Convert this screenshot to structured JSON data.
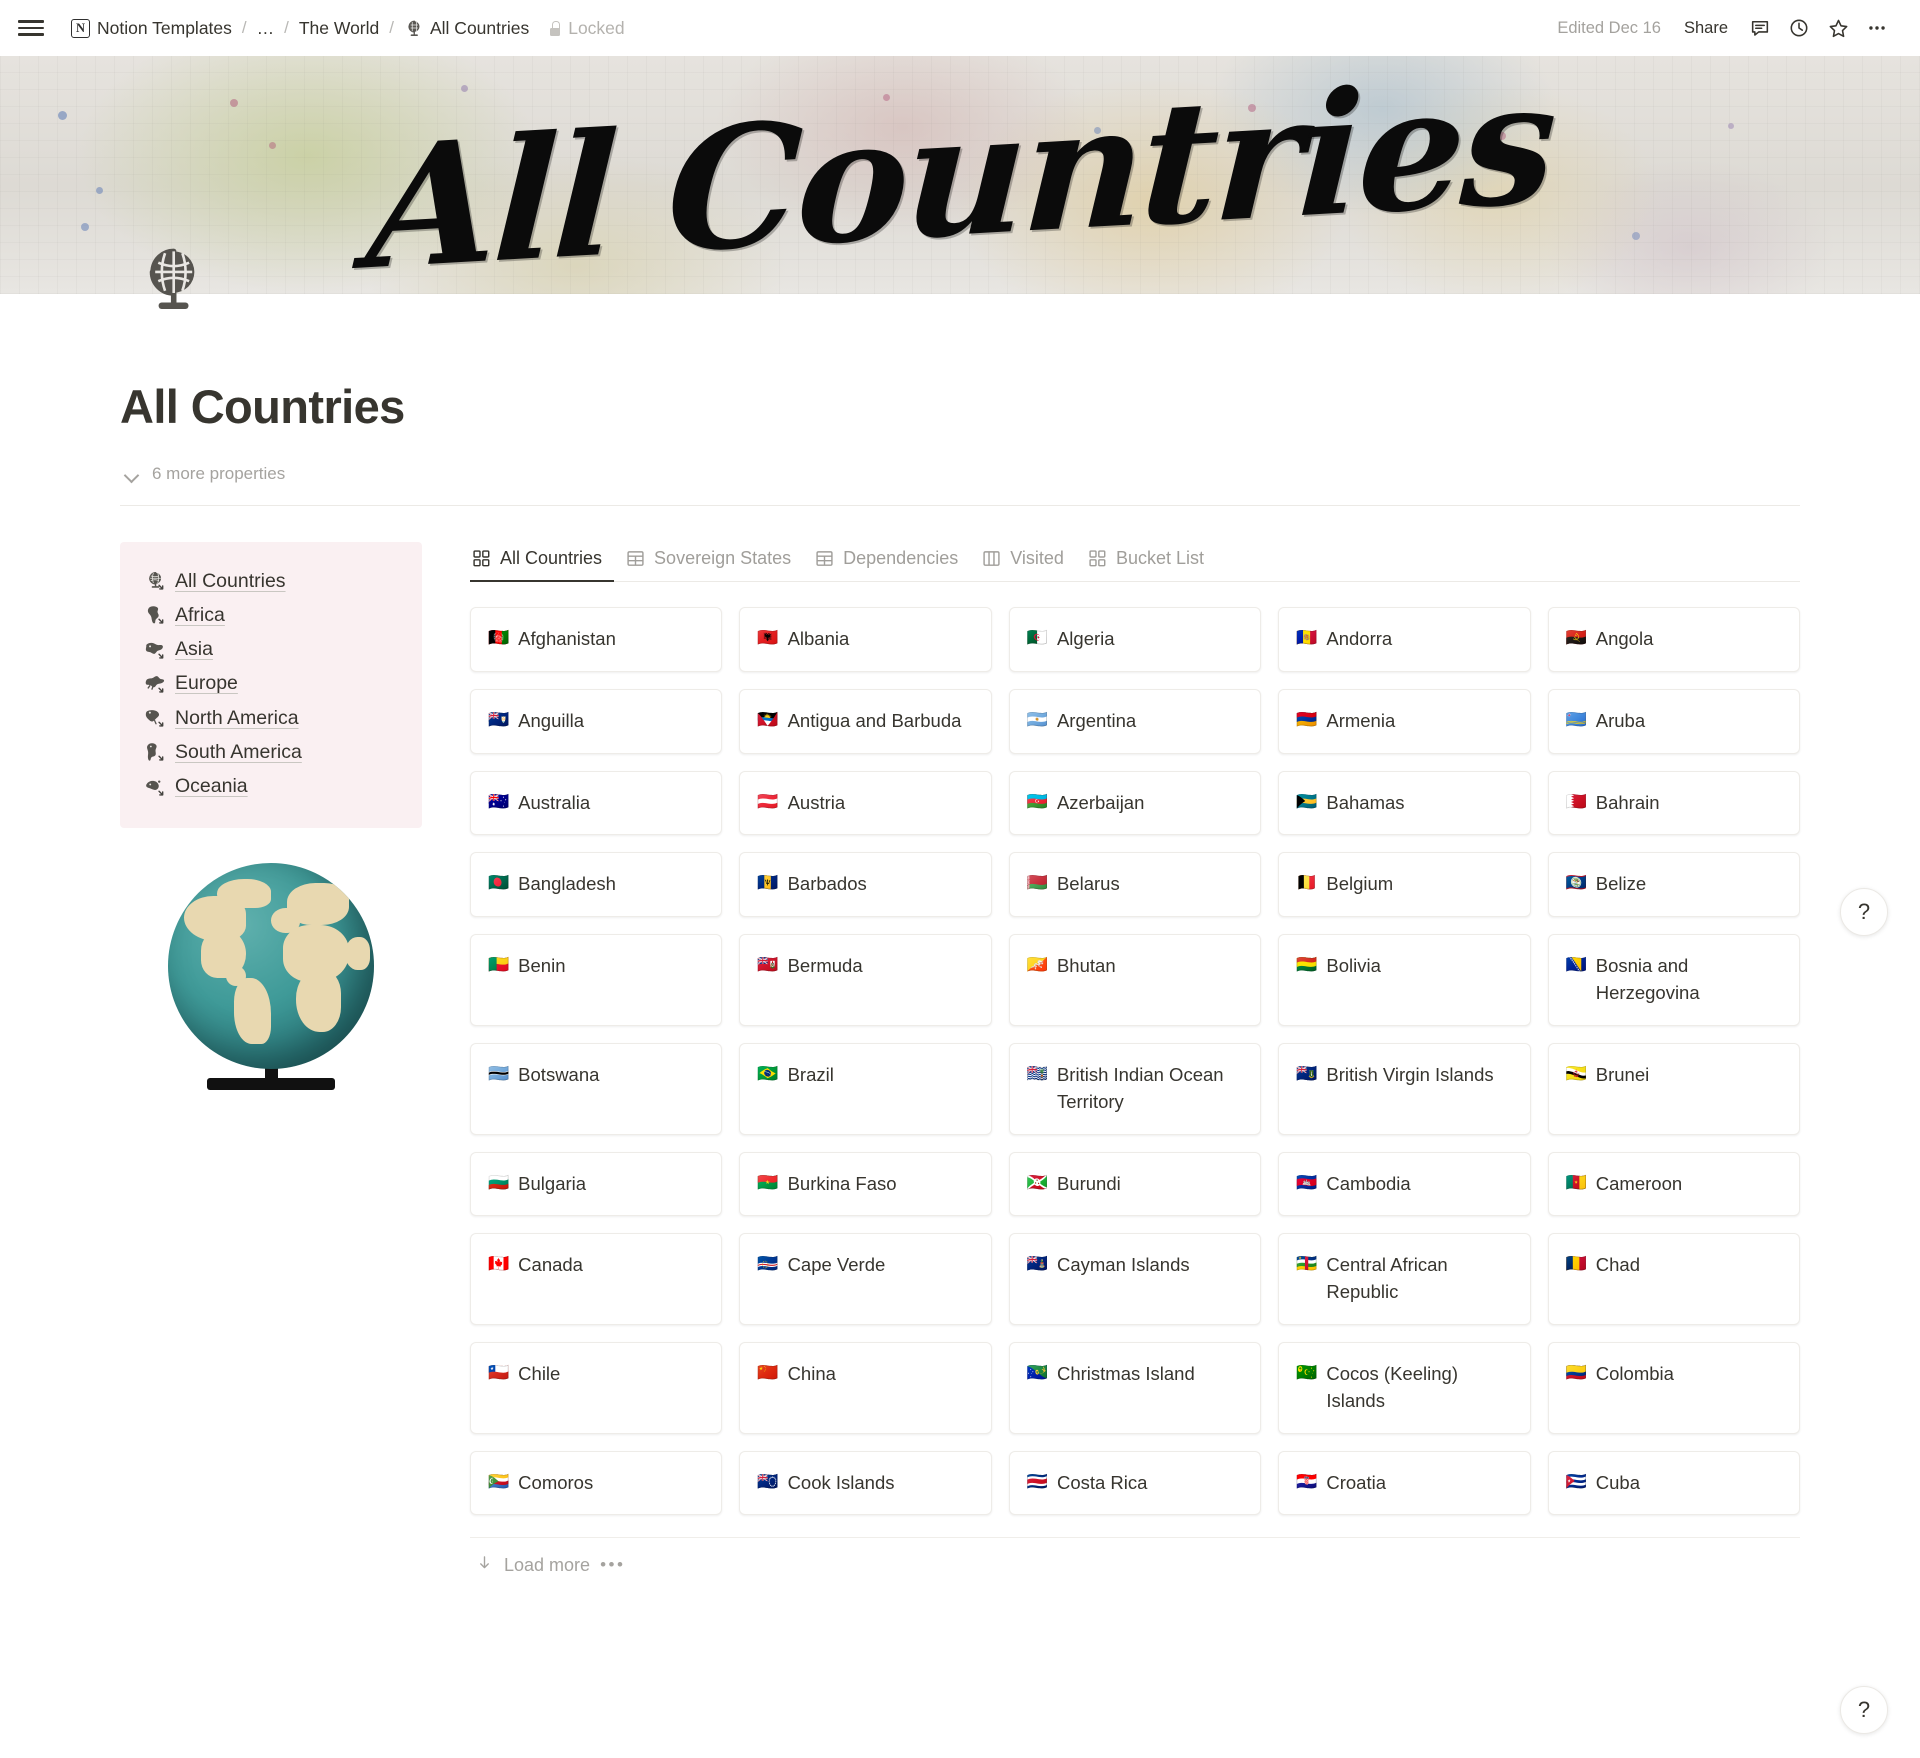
{
  "topbar": {
    "menu_icon": "hamburger-icon",
    "breadcrumb": {
      "workspace": "Notion Templates",
      "ellipsis": "…",
      "parent": "The World",
      "current": "All Countries",
      "separator": "/"
    },
    "locked_label": "Locked",
    "lock_icon": "lock-icon",
    "edited_label": "Edited Dec 16",
    "share_label": "Share",
    "icons": [
      "comment-icon",
      "history-clock-icon",
      "star-icon",
      "more-options-icon"
    ],
    "more_label": "•••"
  },
  "cover": {
    "title_script": "All Countries",
    "alt": "world-map-cover"
  },
  "page": {
    "icon": "globe-stand-icon",
    "title": "All Countries",
    "properties_toggle": "6 more properties",
    "properties_count": 6
  },
  "sidebar": {
    "background_color": "#faf0f2",
    "items": [
      {
        "label": "All Countries",
        "icon": "globe-stand-icon"
      },
      {
        "label": "Africa",
        "icon": "map-africa-icon"
      },
      {
        "label": "Asia",
        "icon": "map-asia-icon"
      },
      {
        "label": "Europe",
        "icon": "map-europe-icon"
      },
      {
        "label": "North America",
        "icon": "map-north-america-icon"
      },
      {
        "label": "South America",
        "icon": "map-south-america-icon"
      },
      {
        "label": "Oceania",
        "icon": "map-oceania-icon"
      }
    ],
    "illustration": "globe-on-stand-image"
  },
  "database": {
    "tabs": [
      {
        "label": "All Countries",
        "icon": "gallery-view-icon",
        "active": true
      },
      {
        "label": "Sovereign States",
        "icon": "table-view-icon",
        "active": false
      },
      {
        "label": "Dependencies",
        "icon": "table-view-icon",
        "active": false
      },
      {
        "label": "Visited",
        "icon": "board-view-icon",
        "active": false
      },
      {
        "label": "Bucket List",
        "icon": "gallery-view-icon",
        "active": false
      }
    ],
    "load_more_label": "Load more",
    "load_more_icon": "arrow-down-icon",
    "load_more_more": "•••",
    "cards": [
      {
        "name": "Afghanistan",
        "flag": "🇦🇫"
      },
      {
        "name": "Albania",
        "flag": "🇦🇱"
      },
      {
        "name": "Algeria",
        "flag": "🇩🇿"
      },
      {
        "name": "Andorra",
        "flag": "🇦🇩"
      },
      {
        "name": "Angola",
        "flag": "🇦🇴"
      },
      {
        "name": "Anguilla",
        "flag": "🇦🇮"
      },
      {
        "name": "Antigua and Barbuda",
        "flag": "🇦🇬"
      },
      {
        "name": "Argentina",
        "flag": "🇦🇷"
      },
      {
        "name": "Armenia",
        "flag": "🇦🇲"
      },
      {
        "name": "Aruba",
        "flag": "🇦🇼"
      },
      {
        "name": "Australia",
        "flag": "🇦🇺"
      },
      {
        "name": "Austria",
        "flag": "🇦🇹"
      },
      {
        "name": "Azerbaijan",
        "flag": "🇦🇿"
      },
      {
        "name": "Bahamas",
        "flag": "🇧🇸"
      },
      {
        "name": "Bahrain",
        "flag": "🇧🇭"
      },
      {
        "name": "Bangladesh",
        "flag": "🇧🇩"
      },
      {
        "name": "Barbados",
        "flag": "🇧🇧"
      },
      {
        "name": "Belarus",
        "flag": "🇧🇾"
      },
      {
        "name": "Belgium",
        "flag": "🇧🇪"
      },
      {
        "name": "Belize",
        "flag": "🇧🇿"
      },
      {
        "name": "Benin",
        "flag": "🇧🇯"
      },
      {
        "name": "Bermuda",
        "flag": "🇧🇲"
      },
      {
        "name": "Bhutan",
        "flag": "🇧🇹"
      },
      {
        "name": "Bolivia",
        "flag": "🇧🇴"
      },
      {
        "name": "Bosnia and Herzegovina",
        "flag": "🇧🇦"
      },
      {
        "name": "Botswana",
        "flag": "🇧🇼"
      },
      {
        "name": "Brazil",
        "flag": "🇧🇷"
      },
      {
        "name": "British Indian Ocean Territory",
        "flag": "🇮🇴"
      },
      {
        "name": "British Virgin Islands",
        "flag": "🇻🇬"
      },
      {
        "name": "Brunei",
        "flag": "🇧🇳"
      },
      {
        "name": "Bulgaria",
        "flag": "🇧🇬"
      },
      {
        "name": "Burkina Faso",
        "flag": "🇧🇫"
      },
      {
        "name": "Burundi",
        "flag": "🇧🇮"
      },
      {
        "name": "Cambodia",
        "flag": "🇰🇭"
      },
      {
        "name": "Cameroon",
        "flag": "🇨🇲"
      },
      {
        "name": "Canada",
        "flag": "🇨🇦"
      },
      {
        "name": "Cape Verde",
        "flag": "🇨🇻"
      },
      {
        "name": "Cayman Islands",
        "flag": "🇰🇾"
      },
      {
        "name": "Central African Republic",
        "flag": "🇨🇫"
      },
      {
        "name": "Chad",
        "flag": "🇹🇩"
      },
      {
        "name": "Chile",
        "flag": "🇨🇱"
      },
      {
        "name": "China",
        "flag": "🇨🇳"
      },
      {
        "name": "Christmas Island",
        "flag": "🇨🇽"
      },
      {
        "name": "Cocos (Keeling) Islands",
        "flag": "🇨🇨"
      },
      {
        "name": "Colombia",
        "flag": "🇨🇴"
      },
      {
        "name": "Comoros",
        "flag": "🇰🇲"
      },
      {
        "name": "Cook Islands",
        "flag": "🇨🇰"
      },
      {
        "name": "Costa Rica",
        "flag": "🇨🇷"
      },
      {
        "name": "Croatia",
        "flag": "🇭🇷"
      },
      {
        "name": "Cuba",
        "flag": "🇨🇺"
      }
    ]
  },
  "help": {
    "label": "?"
  }
}
